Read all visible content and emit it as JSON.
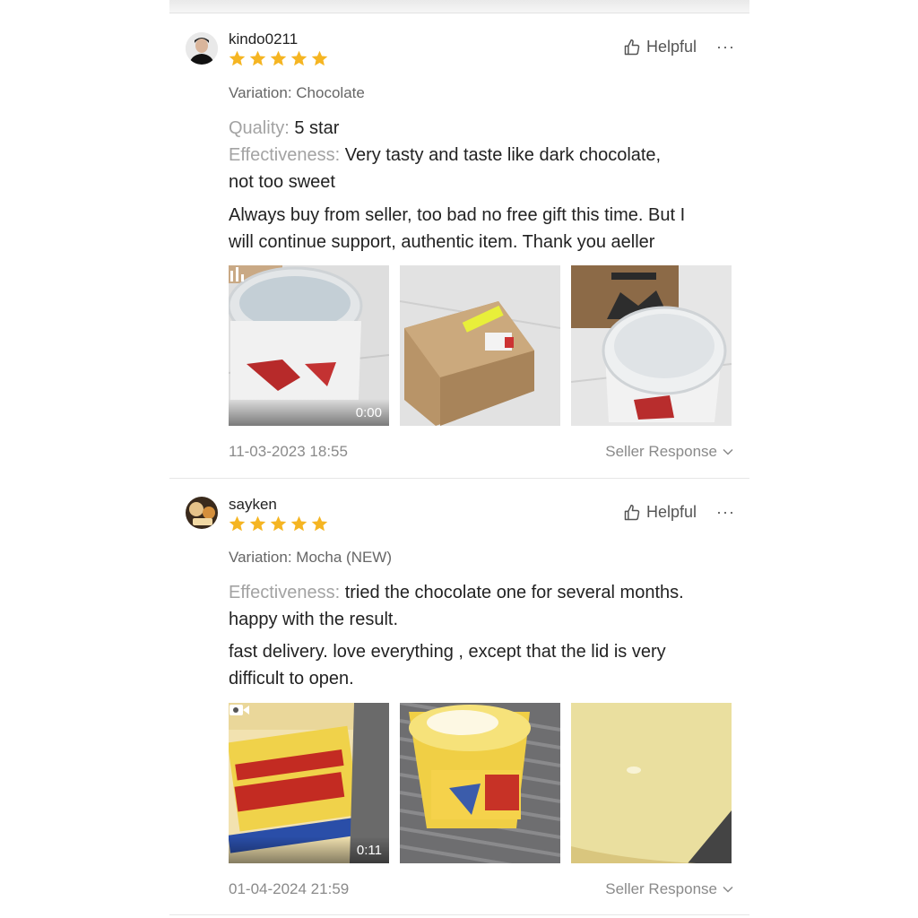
{
  "reviews": [
    {
      "username": "kindo0211",
      "rating": 5,
      "helpful_label": "Helpful",
      "more_label": "···",
      "variation": "Variation: Chocolate",
      "quality_label": "Quality:",
      "quality_value": "5 star",
      "effectiveness_label": "Effectiveness:",
      "effectiveness_line1": "Very tasty and taste like dark chocolate,",
      "effectiveness_line2": "not too sweet",
      "comment_line1": "Always buy from seller, too bad no free gift this time. But I",
      "comment_line2": "will continue support, authentic item. Thank you aeller",
      "video_duration": "0:00",
      "date": "11-03-2023 18:55",
      "seller_response_label": "Seller Response"
    },
    {
      "username": "sayken",
      "rating": 5,
      "helpful_label": "Helpful",
      "more_label": "···",
      "variation": "Variation: Mocha (NEW)",
      "effectiveness_label": "Effectiveness:",
      "effectiveness_line1": "tried the chocolate one for several months.",
      "effectiveness_line2": "happy with the result.",
      "comment_line1": "fast delivery. love everything , except that the lid is very",
      "comment_line2": "difficult to open.",
      "video_duration": "0:11",
      "date": "01-04-2024 21:59",
      "seller_response_label": "Seller Response"
    }
  ],
  "colors": {
    "star": "#f5b522",
    "muted": "#8a8a8a",
    "label": "#a3a3a3"
  }
}
